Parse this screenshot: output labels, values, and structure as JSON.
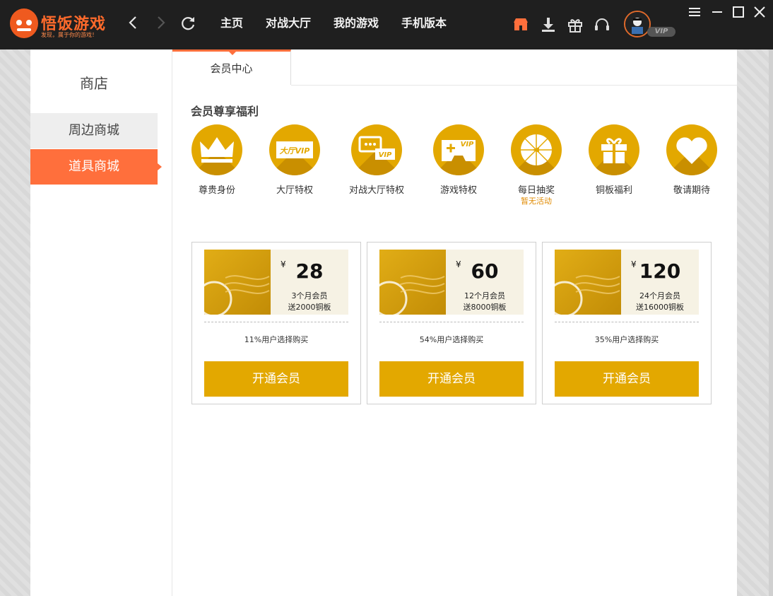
{
  "app": {
    "name": "悟饭游戏",
    "slogan": "发现，属于你的游戏！",
    "nav": [
      "主页",
      "对战大厅",
      "我的游戏",
      "手机版本"
    ],
    "vip_tag": "VIP"
  },
  "colors": {
    "accent": "#ff6f3c",
    "gold": "#e3a800",
    "topbar": "#1f1f1f"
  },
  "sidebar": {
    "title": "商店",
    "items": [
      {
        "label": "周边商城",
        "active": false
      },
      {
        "label": "道具商城",
        "active": true
      }
    ]
  },
  "tabs": [
    {
      "label": "会员中心",
      "active": true
    }
  ],
  "benefits_title": "会员尊享福利",
  "benefits": [
    {
      "label": "尊贵身份",
      "icon": "crown-icon"
    },
    {
      "label": "大厅特权",
      "icon": "hall-vip-icon",
      "icon_text": "大厅VIP"
    },
    {
      "label": "对战大厅特权",
      "icon": "chat-vip-icon",
      "icon_text": "VIP"
    },
    {
      "label": "游戏特权",
      "icon": "gamepad-vip-icon",
      "icon_text": "VIP"
    },
    {
      "label": "每日抽奖",
      "icon": "lottery-wheel-icon",
      "sub": "暂无活动"
    },
    {
      "label": "铜板福利",
      "icon": "gift-icon"
    },
    {
      "label": "敬请期待",
      "icon": "heart-icon"
    }
  ],
  "plans": [
    {
      "currency": "¥",
      "price": "28",
      "plan": "3个月会员",
      "gift": "送2000铜板",
      "pct": "11%用户选择购买",
      "button": "开通会员"
    },
    {
      "currency": "¥",
      "price": "60",
      "plan": "12个月会员",
      "gift": "送8000铜板",
      "pct": "54%用户选择购买",
      "button": "开通会员"
    },
    {
      "currency": "¥",
      "price": "120",
      "plan": "24个月会员",
      "gift": "送16000铜板",
      "pct": "35%用户选择购买",
      "button": "开通会员"
    }
  ]
}
